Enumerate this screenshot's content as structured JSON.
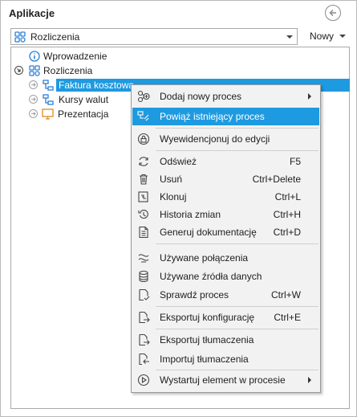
{
  "header": {
    "title": "Aplikacje"
  },
  "selector": {
    "value": "Rozliczenia",
    "new_label": "Nowy"
  },
  "tree": {
    "items": [
      {
        "label": "Wprowadzenie"
      },
      {
        "label": "Rozliczenia"
      },
      {
        "label": "Faktura kosztowa"
      },
      {
        "label": "Kursy walut"
      },
      {
        "label": "Prezentacja"
      }
    ]
  },
  "context_menu": {
    "items": [
      {
        "label": "Dodaj nowy proces",
        "shortcut": ""
      },
      {
        "label": "Powiąż istniejący proces",
        "shortcut": ""
      },
      {
        "label": "Wyewidencjonuj do edycji",
        "shortcut": ""
      },
      {
        "label": "Odśwież",
        "shortcut": "F5"
      },
      {
        "label": "Usuń",
        "shortcut": "Ctrl+Delete"
      },
      {
        "label": "Klonuj",
        "shortcut": "Ctrl+L"
      },
      {
        "label": "Historia zmian",
        "shortcut": "Ctrl+H"
      },
      {
        "label": "Generuj dokumentację",
        "shortcut": "Ctrl+D"
      },
      {
        "label": "Używane połączenia",
        "shortcut": ""
      },
      {
        "label": "Używane źródła danych",
        "shortcut": ""
      },
      {
        "label": "Sprawdź proces",
        "shortcut": "Ctrl+W"
      },
      {
        "label": "Eksportuj konfigurację",
        "shortcut": "Ctrl+E"
      },
      {
        "label": "Eksportuj tłumaczenia",
        "shortcut": ""
      },
      {
        "label": "Importuj tłumaczenia",
        "shortcut": ""
      },
      {
        "label": "Wystartuj element w procesie",
        "shortcut": ""
      }
    ]
  },
  "colors": {
    "selection": "#1e9ae0",
    "icon_blue": "#2a7fd4",
    "menu_bg": "#f2f2f2"
  }
}
